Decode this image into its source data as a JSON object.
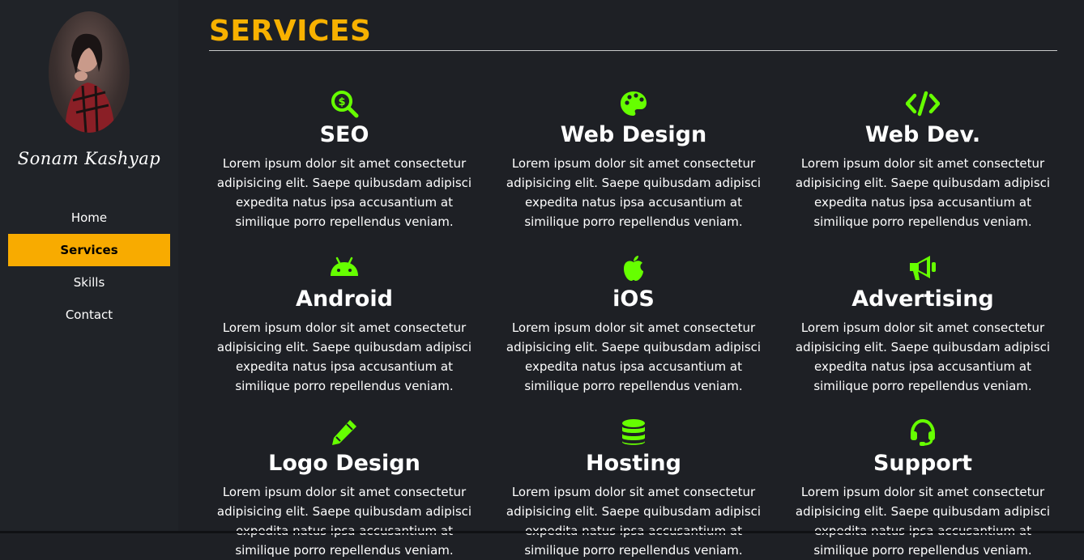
{
  "profile": {
    "name": "Sonam Kashyap"
  },
  "nav": {
    "items": [
      {
        "label": "Home"
      },
      {
        "label": "Services"
      },
      {
        "label": "Skills"
      },
      {
        "label": "Contact"
      }
    ],
    "active_index": 1
  },
  "page": {
    "title": "SERVICES"
  },
  "colors": {
    "accent": "#f8ab00",
    "title": "#f8b100",
    "icon": "#66ff00",
    "background": "#1e2025"
  },
  "services": [
    {
      "title": "SEO",
      "icon": "search-dollar-icon",
      "description": "Lorem ipsum dolor sit amet consectetur adipisicing elit. Saepe quibusdam adipisci expedita natus ipsa accusantium at similique porro repellendus veniam."
    },
    {
      "title": "Web Design",
      "icon": "palette-icon",
      "description": "Lorem ipsum dolor sit amet consectetur adipisicing elit. Saepe quibusdam adipisci expedita natus ipsa accusantium at similique porro repellendus veniam."
    },
    {
      "title": "Web Dev.",
      "icon": "code-icon",
      "description": "Lorem ipsum dolor sit amet consectetur adipisicing elit. Saepe quibusdam adipisci expedita natus ipsa accusantium at similique porro repellendus veniam."
    },
    {
      "title": "Android",
      "icon": "android-icon",
      "description": "Lorem ipsum dolor sit amet consectetur adipisicing elit. Saepe quibusdam adipisci expedita natus ipsa accusantium at similique porro repellendus veniam."
    },
    {
      "title": "iOS",
      "icon": "apple-icon",
      "description": "Lorem ipsum dolor sit amet consectetur adipisicing elit. Saepe quibusdam adipisci expedita natus ipsa accusantium at similique porro repellendus veniam."
    },
    {
      "title": "Advertising",
      "icon": "megaphone-icon",
      "description": "Lorem ipsum dolor sit amet consectetur adipisicing elit. Saepe quibusdam adipisci expedita natus ipsa accusantium at similique porro repellendus veniam."
    },
    {
      "title": "Logo Design",
      "icon": "pencil-icon",
      "description": "Lorem ipsum dolor sit amet consectetur adipisicing elit. Saepe quibusdam adipisci expedita natus ipsa accusantium at similique porro repellendus veniam."
    },
    {
      "title": "Hosting",
      "icon": "database-icon",
      "description": "Lorem ipsum dolor sit amet consectetur adipisicing elit. Saepe quibusdam adipisci expedita natus ipsa accusantium at similique porro repellendus veniam."
    },
    {
      "title": "Support",
      "icon": "headset-icon",
      "description": "Lorem ipsum dolor sit amet consectetur adipisicing elit. Saepe quibusdam adipisci expedita natus ipsa accusantium at similique porro repellendus veniam."
    }
  ]
}
